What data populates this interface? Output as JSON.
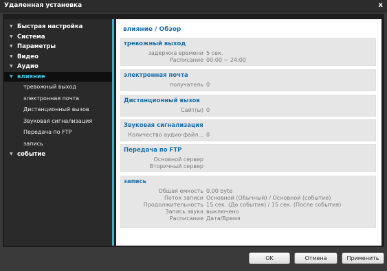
{
  "window": {
    "title": "Удаленная установка",
    "close": "x"
  },
  "sidebar": {
    "items": [
      {
        "label": "Быстрая настройка"
      },
      {
        "label": "Система"
      },
      {
        "label": "Параметры"
      },
      {
        "label": "Видео"
      },
      {
        "label": "Аудио"
      },
      {
        "label": "влияние",
        "active": true
      },
      {
        "label": "событие"
      }
    ],
    "subitems": [
      "тревожный выход",
      "электронная почта",
      "Дистанционный вызов",
      "Звуковая сигнализация",
      "Передача по FTP",
      "запись"
    ]
  },
  "main": {
    "breadcrumb": "влияние / Обзор",
    "alarm_out": {
      "title": "тревожный выход",
      "delay_label": "задержка времени",
      "delay_value": "5 сек.",
      "schedule_label": "Расписание",
      "schedule_value": "00:00 ~ 24:00"
    },
    "email": {
      "title": "электронная почта",
      "recipient_label": "получатель",
      "recipient_value": "0"
    },
    "remote_call": {
      "title": "Дистанционный вызов",
      "sites_label": "Сайт(ы)",
      "sites_value": "0"
    },
    "sound": {
      "title": "Звуковая сигнализация",
      "files_label": "Количество аудио-файл...",
      "files_value": "0"
    },
    "ftp": {
      "title": "Передача по FTP",
      "primary_label": "Основной сервер",
      "secondary_label": "Вторичный сервер"
    },
    "record": {
      "title": "запись",
      "capacity_label": "Общая емкость",
      "capacity_value": "0.00 byte",
      "stream_label": "Поток записи",
      "stream_value": "Основной (Обычный) / Основной (событие)",
      "duration_label": "Продолжительность",
      "duration_value": "15 сек. (До события) / 15 сек. (После события)",
      "audio_label": "Запись звука",
      "audio_value": "выключено",
      "schedule_label": "Расписание",
      "schedule_value": "Дата/Время"
    }
  },
  "footer": {
    "ok": "OK",
    "cancel": "Отмена",
    "apply": "Применить"
  }
}
